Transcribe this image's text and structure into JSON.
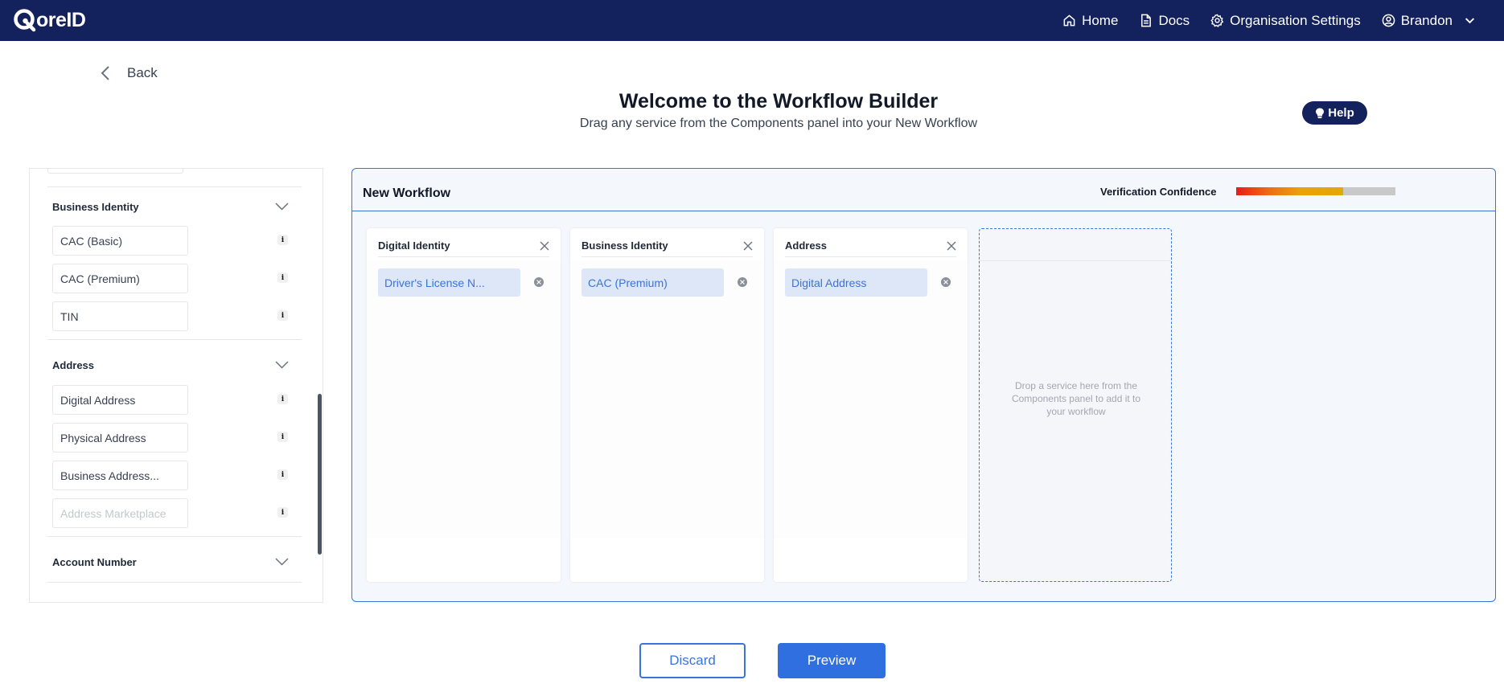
{
  "app": {
    "logo_text": "oreID"
  },
  "nav": {
    "home": "Home",
    "docs": "Docs",
    "org_settings": "Organisation Settings",
    "user": "Brandon"
  },
  "back_label": "Back",
  "header": {
    "title": "Welcome to the Workflow Builder",
    "subtitle": "Drag any service from the Components panel into your New Workflow",
    "help": "Help"
  },
  "components": {
    "groups": [
      {
        "name": "Business Identity",
        "services": [
          {
            "label": "CAC (Basic)",
            "disabled": false
          },
          {
            "label": "CAC (Premium)",
            "disabled": false
          },
          {
            "label": "TIN",
            "disabled": false
          }
        ]
      },
      {
        "name": "Address",
        "services": [
          {
            "label": "Digital Address",
            "disabled": false
          },
          {
            "label": "Physical Address",
            "disabled": false
          },
          {
            "label": "Business Address...",
            "disabled": false
          },
          {
            "label": "Address Marketplace",
            "disabled": true
          }
        ]
      },
      {
        "name": "Account Number",
        "services": []
      }
    ]
  },
  "workflow": {
    "title": "New Workflow",
    "confidence_label": "Verification Confidence",
    "confidence_fraction": 0.67,
    "steps": [
      {
        "name": "Digital Identity",
        "service": "Driver's License N..."
      },
      {
        "name": "Business Identity",
        "service": "CAC (Premium)"
      },
      {
        "name": "Address",
        "service": "Digital Address"
      }
    ],
    "drop_hint": "Drop a service here from the Components panel to add it to your workflow"
  },
  "footer": {
    "discard": "Discard",
    "preview": "Preview"
  },
  "colors": {
    "nav_bg": "#13215c",
    "accent": "#3b74d9",
    "primary_button": "#2f6fe0"
  }
}
